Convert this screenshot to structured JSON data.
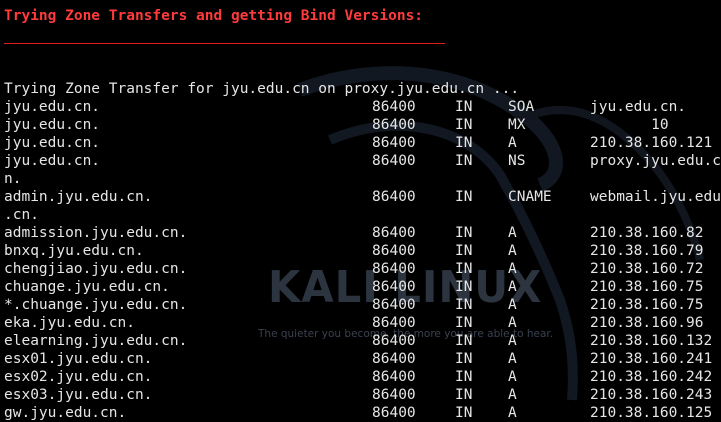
{
  "header": {
    "title": "Trying Zone Transfers and getting Bind Versions:"
  },
  "watermark": {
    "brand": "KALI LINUX",
    "tagline": "The quieter you become, the more you are able to hear."
  },
  "intro_line": "Trying Zone Transfer for jyu.edu.cn on proxy.jyu.edu.cn ...",
  "records": [
    {
      "name": "jyu.edu.cn.",
      "ttl": "86400",
      "class": "IN",
      "type": "SOA",
      "value": "jyu.edu.cn."
    },
    {
      "name": "jyu.edu.cn.",
      "ttl": "86400",
      "class": "IN",
      "type": "MX",
      "value": "       10"
    },
    {
      "name": "jyu.edu.cn.",
      "ttl": "86400",
      "class": "IN",
      "type": "A",
      "value": "210.38.160.121"
    },
    {
      "name": "jyu.edu.cn.",
      "ttl": "86400",
      "class": "IN",
      "type": "NS",
      "value": "proxy.jyu.edu.c"
    },
    {
      "wrap": "n."
    },
    {
      "name": "admin.jyu.edu.cn.",
      "ttl": "86400",
      "class": "IN",
      "type": "CNAME",
      "value": "webmail.jyu.edu"
    },
    {
      "wrap": ".cn."
    },
    {
      "name": "admission.jyu.edu.cn.",
      "ttl": "86400",
      "class": "IN",
      "type": "A",
      "value": "210.38.160.82"
    },
    {
      "name": "bnxq.jyu.edu.cn.",
      "ttl": "86400",
      "class": "IN",
      "type": "A",
      "value": "210.38.160.79"
    },
    {
      "name": "chengjiao.jyu.edu.cn.",
      "ttl": "86400",
      "class": "IN",
      "type": "A",
      "value": "210.38.160.72"
    },
    {
      "name": "chuange.jyu.edu.cn.",
      "ttl": "86400",
      "class": "IN",
      "type": "A",
      "value": "210.38.160.75"
    },
    {
      "name": "*.chuange.jyu.edu.cn.",
      "ttl": "86400",
      "class": "IN",
      "type": "A",
      "value": "210.38.160.75"
    },
    {
      "name": "eka.jyu.edu.cn.",
      "ttl": "86400",
      "class": "IN",
      "type": "A",
      "value": "210.38.160.96"
    },
    {
      "name": "elearning.jyu.edu.cn.",
      "ttl": "86400",
      "class": "IN",
      "type": "A",
      "value": "210.38.160.132"
    },
    {
      "name": "esx01.jyu.edu.cn.",
      "ttl": "86400",
      "class": "IN",
      "type": "A",
      "value": "210.38.160.241"
    },
    {
      "name": "esx02.jyu.edu.cn.",
      "ttl": "86400",
      "class": "IN",
      "type": "A",
      "value": "210.38.160.242"
    },
    {
      "name": "esx03.jyu.edu.cn.",
      "ttl": "86400",
      "class": "IN",
      "type": "A",
      "value": "210.38.160.243"
    },
    {
      "name": "gw.jyu.edu.cn.",
      "ttl": "86400",
      "class": "IN",
      "type": "A",
      "value": "210.38.160.125"
    }
  ],
  "colors": {
    "background": "#000000",
    "text": "#e6e6e6",
    "header": "#ff3b3b",
    "rule": "#e02020"
  }
}
